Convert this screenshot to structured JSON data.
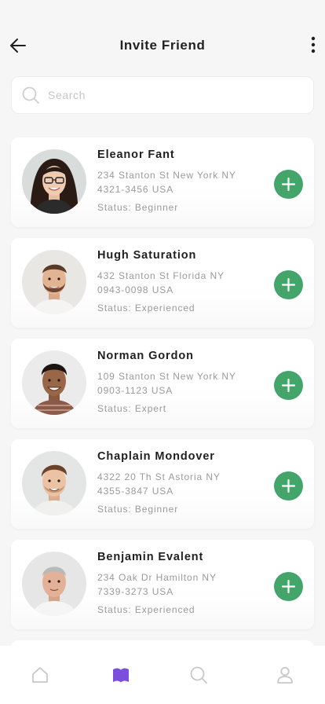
{
  "header": {
    "title": "Invite Friend",
    "back_icon": "arrow-left-icon",
    "more_icon": "more-vertical-icon"
  },
  "search": {
    "placeholder": "Search",
    "value": "",
    "icon": "search-icon"
  },
  "friends": [
    {
      "name": "Eleanor Fant",
      "address_line1": "234 Stanton St New York NY",
      "address_line2": "4321-3456 USA",
      "status": "Status: Beginner"
    },
    {
      "name": "Hugh Saturation",
      "address_line1": "432 Stanton St Florida NY",
      "address_line2": "0943-0098 USA",
      "status": "Status: Experienced"
    },
    {
      "name": "Norman Gordon",
      "address_line1": "109 Stanton St New York NY",
      "address_line2": "0903-1123 USA",
      "status": "Status: Expert"
    },
    {
      "name": "Chaplain Mondover",
      "address_line1": "4322 20 Th St Astoria NY",
      "address_line2": "4355-3847 USA",
      "status": "Status: Beginner"
    },
    {
      "name": "Benjamin Evalent",
      "address_line1": "234 Oak Dr Hamilton NY",
      "address_line2": "7339-3273 USA",
      "status": "Status: Experienced"
    }
  ],
  "tabbar": {
    "items": [
      "home-icon",
      "book-icon",
      "search-icon",
      "user-icon"
    ],
    "active": "book-icon"
  },
  "colors": {
    "accent": "#43a56a",
    "active_tab": "#7b4ee0",
    "inactive_tab": "#c8c8c8",
    "background": "#f6f6f6"
  }
}
